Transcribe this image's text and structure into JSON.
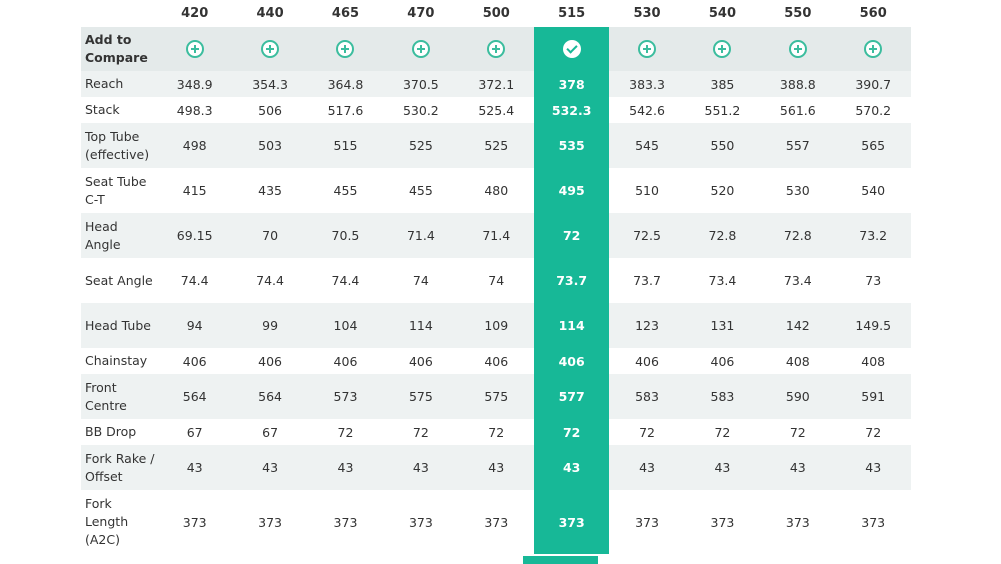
{
  "sizes": [
    "420",
    "440",
    "465",
    "470",
    "500",
    "515",
    "530",
    "540",
    "550",
    "560"
  ],
  "selected_size": "515",
  "compare_label": "Add to Compare",
  "colors": {
    "accent": "#17b897",
    "row_alt": "#eef2f2",
    "icon": "#3bbd9e"
  },
  "icons": {
    "add": "plus-circle-icon",
    "selected": "check-circle-icon"
  },
  "rows": [
    {
      "label": "Reach",
      "values": [
        "348.9",
        "354.3",
        "364.8",
        "370.5",
        "372.1",
        "378",
        "383.3",
        "385",
        "388.8",
        "390.7"
      ]
    },
    {
      "label": "Stack",
      "values": [
        "498.3",
        "506",
        "517.6",
        "530.2",
        "525.4",
        "532.3",
        "542.6",
        "551.2",
        "561.6",
        "570.2"
      ]
    },
    {
      "label": "Top Tube (effective)",
      "values": [
        "498",
        "503",
        "515",
        "525",
        "525",
        "535",
        "545",
        "550",
        "557",
        "565"
      ]
    },
    {
      "label": "Seat Tube C-T",
      "values": [
        "415",
        "435",
        "455",
        "455",
        "480",
        "495",
        "510",
        "520",
        "530",
        "540"
      ]
    },
    {
      "label": "Head Angle",
      "values": [
        "69.15",
        "70",
        "70.5",
        "71.4",
        "71.4",
        "72",
        "72.5",
        "72.8",
        "72.8",
        "73.2"
      ]
    },
    {
      "label": "Seat Angle",
      "values": [
        "74.4",
        "74.4",
        "74.4",
        "74",
        "74",
        "73.7",
        "73.7",
        "73.4",
        "73.4",
        "73"
      ]
    },
    {
      "label": "Head Tube",
      "values": [
        "94",
        "99",
        "104",
        "114",
        "109",
        "114",
        "123",
        "131",
        "142",
        "149.5"
      ]
    },
    {
      "label": "Chainstay",
      "values": [
        "406",
        "406",
        "406",
        "406",
        "406",
        "406",
        "406",
        "406",
        "408",
        "408"
      ]
    },
    {
      "label": "Front Centre",
      "values": [
        "564",
        "564",
        "573",
        "575",
        "575",
        "577",
        "583",
        "583",
        "590",
        "591"
      ]
    },
    {
      "label": "BB Drop",
      "values": [
        "67",
        "67",
        "72",
        "72",
        "72",
        "72",
        "72",
        "72",
        "72",
        "72"
      ]
    },
    {
      "label": "Fork Rake / Offset",
      "values": [
        "43",
        "43",
        "43",
        "43",
        "43",
        "43",
        "43",
        "43",
        "43",
        "43"
      ]
    },
    {
      "label": "Fork Length (A2C)",
      "values": [
        "373",
        "373",
        "373",
        "373",
        "373",
        "373",
        "373",
        "373",
        "373",
        "373"
      ]
    }
  ]
}
